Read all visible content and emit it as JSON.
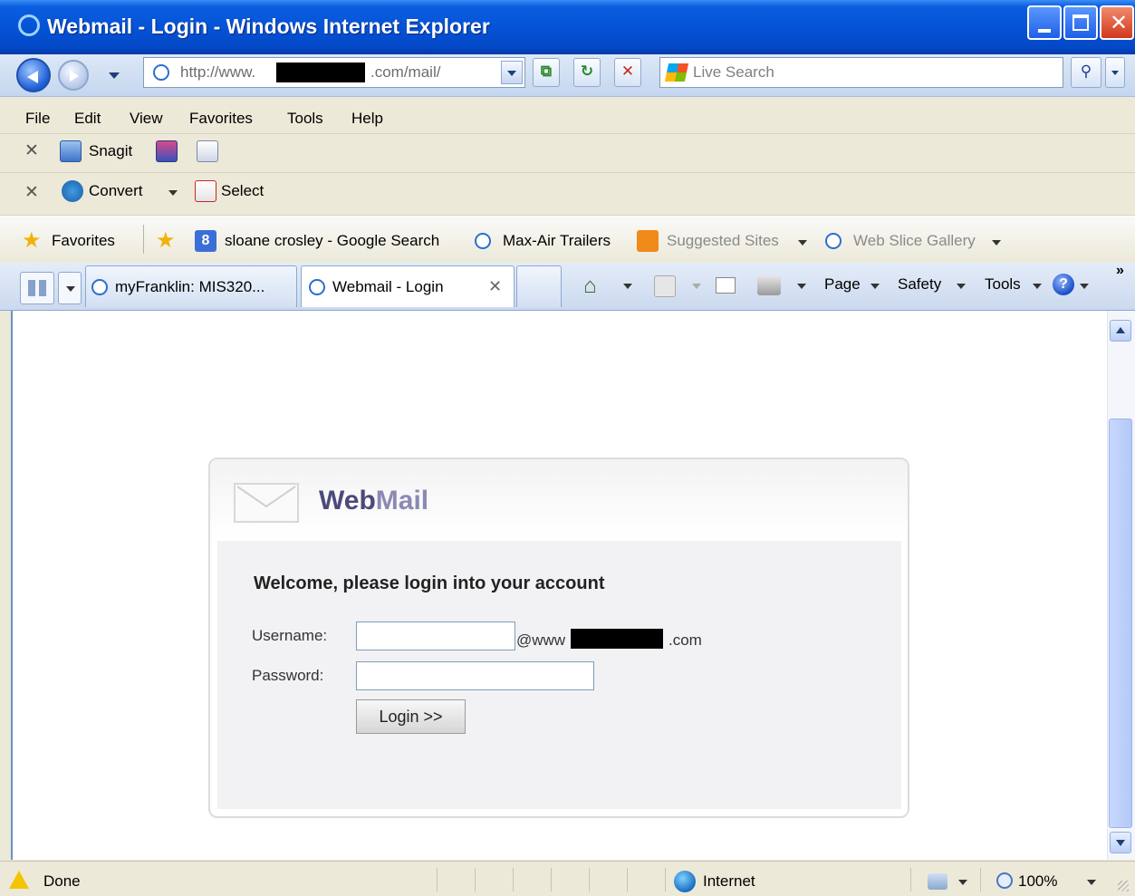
{
  "window": {
    "title": "Webmail - Login - Windows Internet Explorer"
  },
  "navigation": {
    "address_prefix": "http://www.",
    "address_suffix": ".com/mail/",
    "search_placeholder": "Live Search"
  },
  "menu": [
    "File",
    "Edit",
    "View",
    "Favorites",
    "Tools",
    "Help"
  ],
  "toolbars": {
    "snagit_label": "Snagit",
    "convert_label": "Convert",
    "select_label": "Select"
  },
  "favorites_bar": {
    "favorites_label": "Favorites",
    "links": [
      "sloane crosley - Google Search",
      "Max-Air Trailers",
      "Suggested Sites",
      "Web Slice Gallery"
    ]
  },
  "tabs": [
    "myFranklin: MIS320...",
    "Webmail - Login"
  ],
  "command_bar": {
    "page": "Page",
    "safety": "Safety",
    "tools": "Tools"
  },
  "login": {
    "logo_part1": "Web",
    "logo_part2": "Mail",
    "welcome": "Welcome, please login into your account",
    "username_label": "Username:",
    "password_label": "Password:",
    "username_value": "",
    "password_value": "",
    "domain_prefix": "@www",
    "domain_suffix": ".com",
    "login_button": "Login >>"
  },
  "status_bar": {
    "status": "Done",
    "zone": "Internet",
    "zoom": "100%"
  },
  "colors": {
    "titlebar": "#0553d6",
    "logo_dark": "#4a4a7a",
    "logo_light": "#8a8ab5"
  }
}
